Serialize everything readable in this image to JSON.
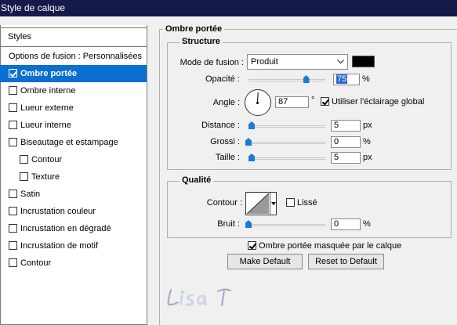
{
  "window": {
    "title": "Style de calque"
  },
  "sidebar": {
    "header": "Styles",
    "items": [
      {
        "label": "Options de fusion : Personnalisées",
        "checkbox": false,
        "checked": false,
        "selected": false,
        "indent": 0
      },
      {
        "label": "Ombre portée",
        "checkbox": true,
        "checked": true,
        "selected": true,
        "indent": 0
      },
      {
        "label": "Ombre interne",
        "checkbox": true,
        "checked": false,
        "selected": false,
        "indent": 0
      },
      {
        "label": "Lueur externe",
        "checkbox": true,
        "checked": false,
        "selected": false,
        "indent": 0
      },
      {
        "label": "Lueur interne",
        "checkbox": true,
        "checked": false,
        "selected": false,
        "indent": 0
      },
      {
        "label": "Biseautage et estampage",
        "checkbox": true,
        "checked": false,
        "selected": false,
        "indent": 0
      },
      {
        "label": "Contour",
        "checkbox": true,
        "checked": false,
        "selected": false,
        "indent": 1
      },
      {
        "label": "Texture",
        "checkbox": true,
        "checked": false,
        "selected": false,
        "indent": 1
      },
      {
        "label": "Satin",
        "checkbox": true,
        "checked": false,
        "selected": false,
        "indent": 0
      },
      {
        "label": "Incrustation couleur",
        "checkbox": true,
        "checked": false,
        "selected": false,
        "indent": 0
      },
      {
        "label": "Incrustation en dégradé",
        "checkbox": true,
        "checked": false,
        "selected": false,
        "indent": 0
      },
      {
        "label": "Incrustation de motif",
        "checkbox": true,
        "checked": false,
        "selected": false,
        "indent": 0
      },
      {
        "label": "Contour",
        "checkbox": true,
        "checked": false,
        "selected": false,
        "indent": 0
      }
    ]
  },
  "panel": {
    "title": "Ombre portée",
    "structure": {
      "title": "Structure",
      "blend_mode_label": "Mode de fusion :",
      "blend_mode_value": "Produit",
      "color": "#000000",
      "opacity_label": "Opacité :",
      "opacity_value": "75",
      "opacity_unit": "%",
      "angle_label": "Angle :",
      "angle_value": "87",
      "angle_unit": "°",
      "global_light_label": "Utiliser l'éclairage global",
      "global_light_checked": true,
      "distance_label": "Distance :",
      "distance_value": "5",
      "distance_unit": "px",
      "spread_label": "Grossi :",
      "spread_value": "0",
      "spread_unit": "%",
      "size_label": "Taille :",
      "size_value": "5",
      "size_unit": "px"
    },
    "quality": {
      "title": "Qualité",
      "contour_label": "Contour :",
      "antialias_label": "Lissé",
      "antialias_checked": false,
      "noise_label": "Bruit :",
      "noise_value": "0",
      "noise_unit": "%"
    },
    "knockout_label": "Ombre portée masquée par le calque",
    "knockout_checked": true,
    "make_default_label": "Make Default",
    "reset_default_label": "Reset to Default"
  },
  "colors": {
    "accent": "#0a6fd0",
    "titlebar": "#151a4a",
    "slider_thumb": "#1a7ad8"
  }
}
